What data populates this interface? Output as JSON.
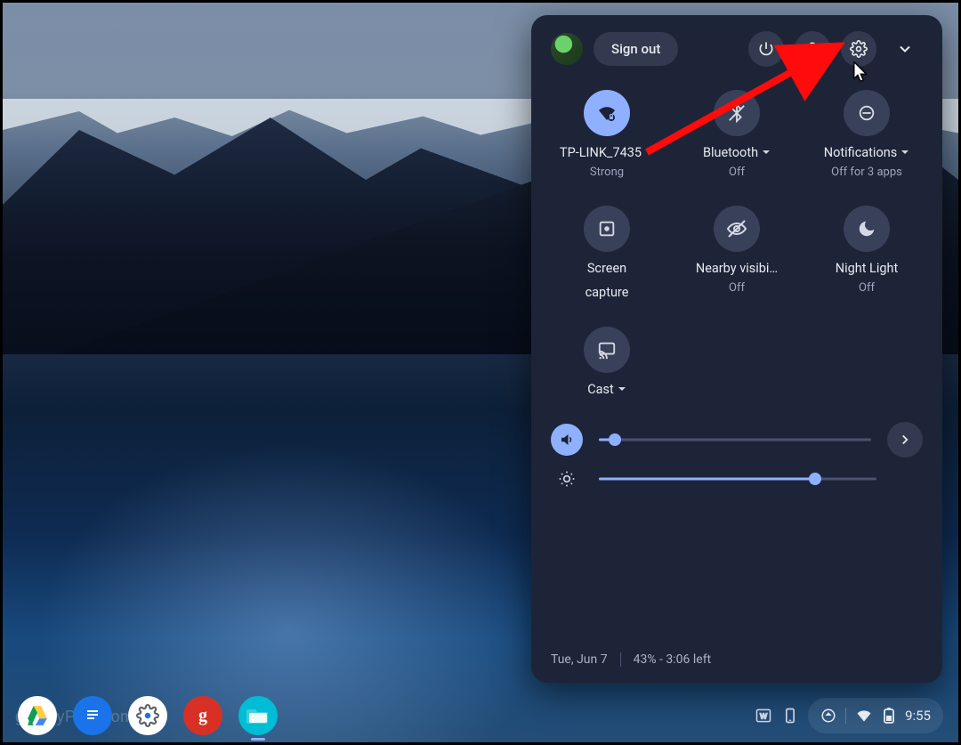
{
  "header": {
    "sign_out": "Sign out"
  },
  "tiles": [
    {
      "id": "wifi",
      "label": "TP-LINK_7435",
      "sub": "Strong",
      "has_caret": true,
      "active": true
    },
    {
      "id": "bluetooth",
      "label": "Bluetooth",
      "sub": "Off",
      "has_caret": true,
      "active": false
    },
    {
      "id": "notifications",
      "label": "Notifications",
      "sub": "Off for 3 apps",
      "has_caret": true,
      "active": false
    },
    {
      "id": "screencap",
      "label": "Screen capture",
      "sub": "",
      "has_caret": false,
      "active": false,
      "multiline": true
    },
    {
      "id": "nearby",
      "label": "Nearby visibi…",
      "sub": "Off",
      "has_caret": false,
      "active": false
    },
    {
      "id": "nightlight",
      "label": "Night Light",
      "sub": "Off",
      "has_caret": false,
      "active": false
    },
    {
      "id": "cast",
      "label": "Cast",
      "sub": "",
      "has_caret": true,
      "active": false
    }
  ],
  "sliders": {
    "volume_pct": 6,
    "brightness_pct": 78
  },
  "footer": {
    "date": "Tue, Jun 7",
    "battery": "43% - 3:06 left"
  },
  "shelf": {
    "time": "9:55"
  },
  "watermark": "groovyPost.com"
}
